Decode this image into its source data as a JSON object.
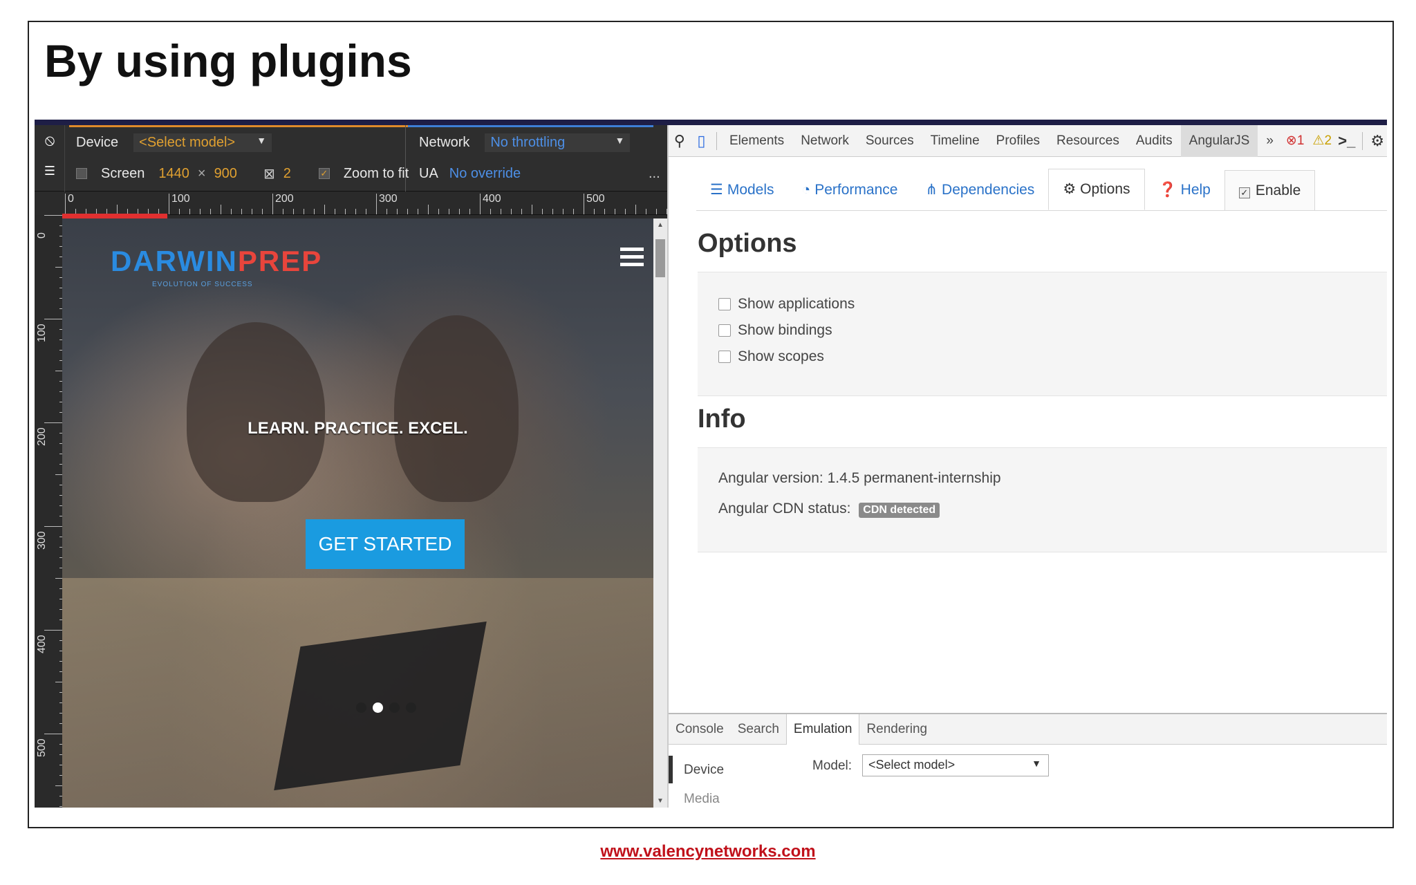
{
  "slide": {
    "title": "By using plugins",
    "footer_link": "www.valencynetworks.com"
  },
  "emulator": {
    "device_label": "Device",
    "device_value": "<Select model>",
    "network_label": "Network",
    "network_value": "No throttling",
    "screen_label": "Screen",
    "screen_width": "1440",
    "screen_x": "×",
    "screen_height": "900",
    "pixel_ratio": "2",
    "zoom_to_fit": "Zoom to fit",
    "ua_label": "UA",
    "ua_value": "No override",
    "more": "...",
    "ruler_top": [
      "0",
      "100",
      "200",
      "300",
      "400",
      "500"
    ],
    "ruler_left": [
      "0",
      "100",
      "200",
      "300",
      "400",
      "500"
    ]
  },
  "site": {
    "logo_part1": "DARWIN",
    "logo_part2": "PREP",
    "logo_sub": "EVOLUTION OF SUCCESS",
    "tagline": "LEARN. PRACTICE. EXCEL.",
    "cta": "GET STARTED",
    "carousel_active_index": 1
  },
  "devtools": {
    "tabs": [
      "Elements",
      "Network",
      "Sources",
      "Timeline",
      "Profiles",
      "Resources",
      "Audits",
      "AngularJS"
    ],
    "active_tab": "AngularJS",
    "overflow": "»",
    "error_count": "1",
    "warning_count": "2",
    "angular_tabs": [
      {
        "label": "Models",
        "icon": "database-icon"
      },
      {
        "label": "Performance",
        "icon": "dashboard-icon"
      },
      {
        "label": "Dependencies",
        "icon": "sitemap-icon"
      },
      {
        "label": "Options",
        "icon": "cogs-icon"
      },
      {
        "label": "Help",
        "icon": "question-icon"
      },
      {
        "label": "Enable",
        "icon": "checkbox-icon"
      }
    ],
    "options_heading": "Options",
    "options": [
      "Show applications",
      "Show bindings",
      "Show scopes"
    ],
    "info_heading": "Info",
    "angular_version_label": "Angular version:",
    "angular_version_value": "1.4.5 permanent-internship",
    "cdn_status_label": "Angular CDN status:",
    "cdn_status_badge": "CDN detected",
    "drawer_tabs": [
      "Console",
      "Search",
      "Emulation",
      "Rendering"
    ],
    "drawer_active": "Emulation",
    "drawer_device": "Device",
    "drawer_media": "Media",
    "drawer_model_label": "Model:",
    "drawer_model_value": "<Select model>"
  },
  "colors": {
    "accent_blue": "#2a72c8",
    "cta_blue": "#1a9be0",
    "logo_blue": "#2a8be0",
    "logo_red": "#e8453c",
    "footer_red": "#c0101a"
  }
}
